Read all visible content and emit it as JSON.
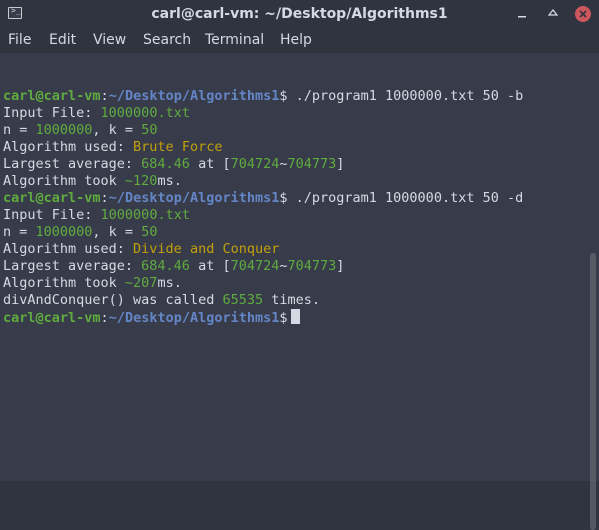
{
  "window": {
    "title": "carl@carl-vm: ~/Desktop/Algorithms1",
    "icon": "terminal-icon"
  },
  "menu": {
    "items": [
      "File",
      "Edit",
      "View",
      "Search",
      "Terminal",
      "Help"
    ]
  },
  "colors": {
    "background": "#383c4a",
    "text": "#d3dae3",
    "user_host": "#5fab3f",
    "path": "#6486c7",
    "number": "#5fab3f",
    "algorithm_name": "#c1a00b"
  },
  "terminal": {
    "prompt_user": "carl@carl-vm",
    "prompt_sep": ":",
    "prompt_path": "~/Desktop/Algorithms1",
    "prompt_symbol": "$",
    "run1": {
      "command": " ./program1 1000000.txt 50 -b",
      "input_label": "Input File: ",
      "input_file": "1000000.txt",
      "n_label": "n = ",
      "n": "1000000",
      "k_label": ", k = ",
      "k": "50",
      "algo_label": "Algorithm used: ",
      "algo": "Brute Force",
      "avg_label": "Largest average: ",
      "avg": "684.46",
      "at_label": " at [",
      "range_start": "704724",
      "range_sep": "~",
      "range_end": "704773",
      "range_close": "]",
      "took_label": "Algorithm took ",
      "took_value": "~120",
      "took_unit": "ms."
    },
    "run2": {
      "command": " ./program1 1000000.txt 50 -d",
      "input_label": "Input File: ",
      "input_file": "1000000.txt",
      "n_label": "n = ",
      "n": "1000000",
      "k_label": ", k = ",
      "k": "50",
      "algo_label": "Algorithm used: ",
      "algo": "Divide and Conquer",
      "avg_label": "Largest average: ",
      "avg": "684.46",
      "at_label": " at [",
      "range_start": "704724",
      "range_sep": "~",
      "range_end": "704773",
      "range_close": "]",
      "took_label": "Algorithm took ",
      "took_value": "~207",
      "took_unit": "ms.",
      "calls_label": "divAndConquer() was called ",
      "calls": "65535",
      "calls_suffix": " times."
    }
  }
}
